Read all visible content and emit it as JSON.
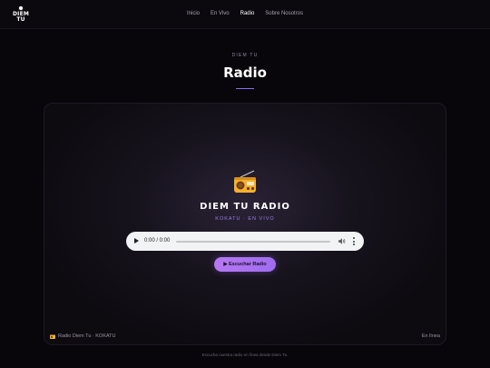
{
  "brand": {
    "line1": "DIEM",
    "line2": "TU"
  },
  "nav": {
    "items": [
      {
        "label": "Inicio"
      },
      {
        "label": "En Vivo"
      },
      {
        "label": "Radio"
      },
      {
        "label": "Sobre Nosotros"
      }
    ],
    "active": "Radio"
  },
  "hero": {
    "eyebrow": "DIEM TU",
    "title": "Radio"
  },
  "station": {
    "name": "DIEM TU RADIO",
    "subtitle": "KOKATU · EN VIVO"
  },
  "player": {
    "time": "0:00 / 0:00"
  },
  "listen_button": {
    "label": "▶ Escuchar Radio"
  },
  "card_footer": {
    "left": "Radio Diem Tu · KOKATU",
    "right": "En línea"
  },
  "page_footer": "Escucha nuestra radio en línea desde Diem Tu.",
  "colors": {
    "accent": "#9f6cf0",
    "background": "#08060b",
    "radio_icon": "#f5b02e"
  },
  "icons": [
    "soccer-ball-icon",
    "radio-icon",
    "play-icon",
    "volume-icon",
    "more-options-icon"
  ]
}
